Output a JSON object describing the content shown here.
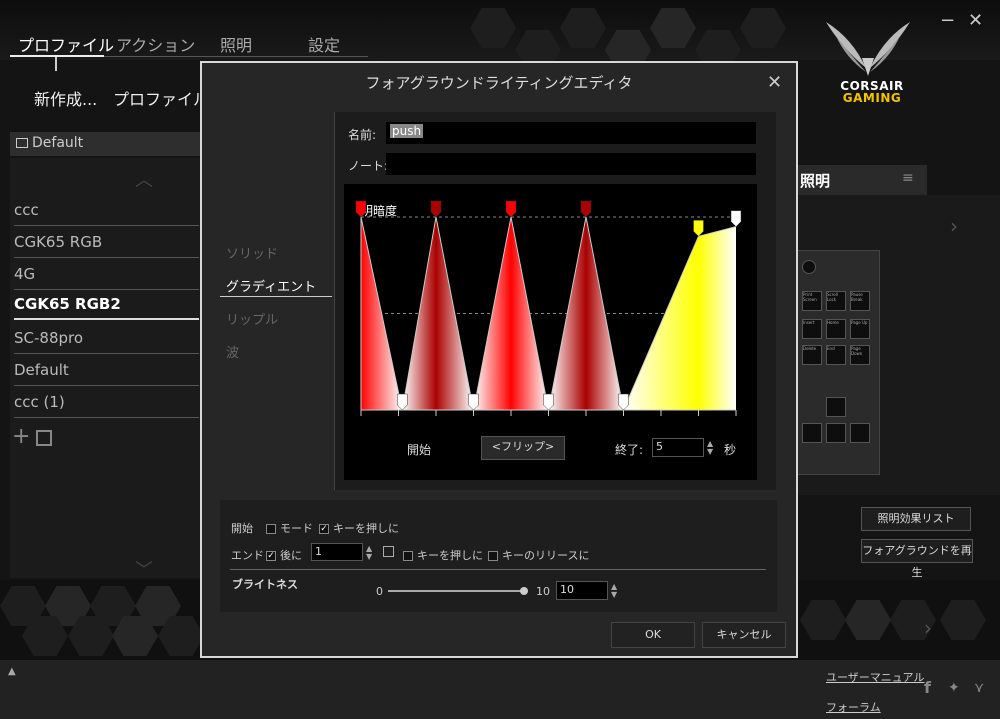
{
  "nav": {
    "tabs": [
      {
        "label": "プロファイル"
      },
      {
        "label": "アクション"
      },
      {
        "label": "照明"
      },
      {
        "label": "設定"
      }
    ],
    "new_label": "新作成...",
    "profile_label": "プロファイルの"
  },
  "window": {
    "minimize": "−",
    "close": "✕"
  },
  "logo": {
    "line1": "CORSAIR",
    "line2": "GAMING"
  },
  "profiles": {
    "header": "Default",
    "items": [
      {
        "label": "ccc"
      },
      {
        "label": "CGK65 RGB"
      },
      {
        "label": "4G"
      },
      {
        "label": "CGK65 RGB2"
      },
      {
        "label": "SC-88pro"
      },
      {
        "label": "Default"
      },
      {
        "label": "ccc (1)"
      }
    ]
  },
  "lighting": {
    "title": "照明",
    "list_button": "照明効果リスト",
    "play_button": "フォアグラウンドを再生",
    "keys": [
      "Print Screen",
      "Scroll Lock",
      "Pause Break",
      "Insert",
      "Home",
      "Page Up",
      "Delete",
      "End",
      "Page Down"
    ]
  },
  "footer": {
    "manual": "ユーザーマニュアル",
    "forum": "フォーラム"
  },
  "modal": {
    "title": "フォアグラウンドライティングエディタ",
    "close": "✕",
    "name_label": "名前:",
    "name_value": "push",
    "note_label": "ノート:",
    "note_value": "",
    "options": [
      {
        "label": "ソリッド"
      },
      {
        "label": "グラディエント"
      },
      {
        "label": "リップル"
      },
      {
        "label": "波"
      }
    ],
    "graph": {
      "brightness_label": "明暗度",
      "start_label": "開始",
      "flip_button": "<フリップ>",
      "end_label": "終了:",
      "end_value": "5",
      "seconds": "秒",
      "stops": [
        {
          "t": 0.0,
          "level": 1.0,
          "color": "#ff0000"
        },
        {
          "t": 0.11,
          "level": 0.0,
          "color": "#ffffff"
        },
        {
          "t": 0.2,
          "level": 1.0,
          "color": "#aa0000"
        },
        {
          "t": 0.3,
          "level": 0.0,
          "color": "#ffffff"
        },
        {
          "t": 0.4,
          "level": 1.0,
          "color": "#ff0000"
        },
        {
          "t": 0.5,
          "level": 0.0,
          "color": "#ffffff"
        },
        {
          "t": 0.6,
          "level": 1.0,
          "color": "#aa0000"
        },
        {
          "t": 0.7,
          "level": 0.0,
          "color": "#ffffff"
        },
        {
          "t": 0.9,
          "level": 0.9,
          "color": "#ffff00"
        },
        {
          "t": 1.0,
          "level": 0.95,
          "color": "#ffffff"
        }
      ]
    },
    "start_section": {
      "label": "開始",
      "mode_label": "モード",
      "mode_checked": false,
      "keypress_label": "キーを押しに",
      "keypress_checked": true
    },
    "end_section": {
      "label": "エンド",
      "after_checked": true,
      "after_label": "後に",
      "after_value": "1",
      "keypress_label": "キーを押しに",
      "keypress_checked": false,
      "release_label": "キーのリリースに",
      "release_checked": false
    },
    "brightness": {
      "label": "ブライトネス",
      "min": "0",
      "max": "10",
      "value": "10",
      "fraction": 1.0
    },
    "ok": "OK",
    "cancel": "キャンセル"
  }
}
